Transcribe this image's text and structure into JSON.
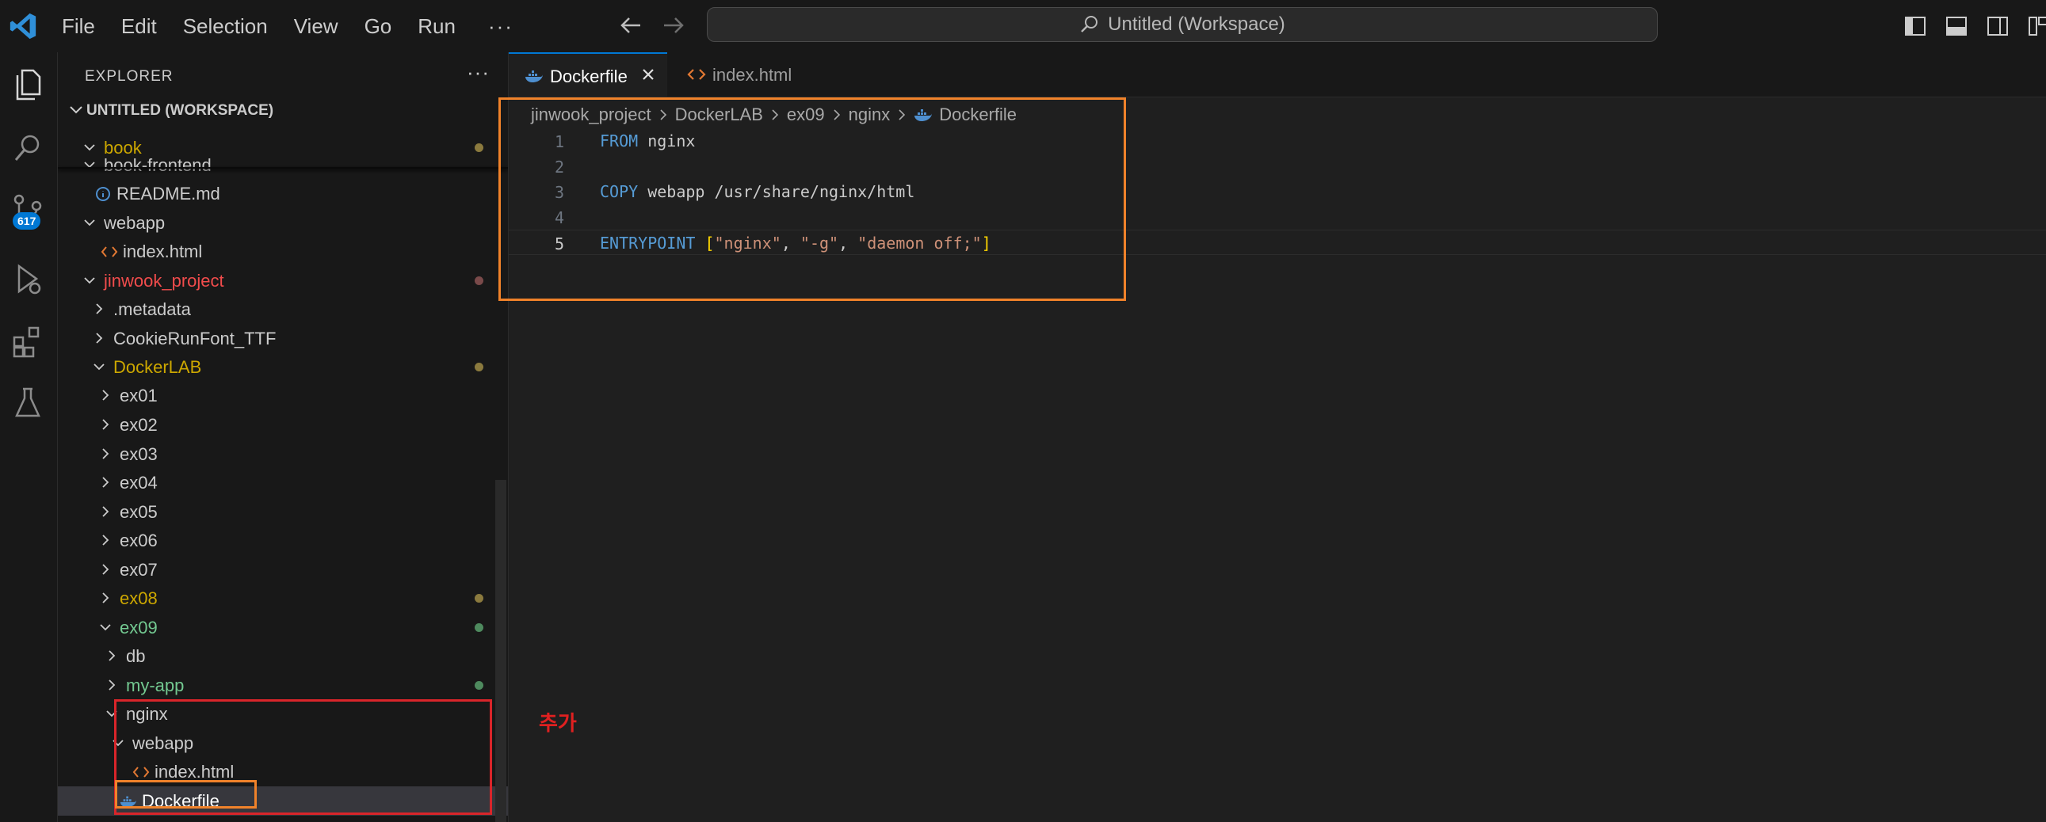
{
  "titlebar": {
    "menu": [
      "File",
      "Edit",
      "Selection",
      "View",
      "Go",
      "Run"
    ],
    "more": "···",
    "command_center": "Untitled (Workspace)"
  },
  "activity": {
    "scm_badge": "617"
  },
  "explorer": {
    "title": "EXPLORER",
    "more": "···",
    "workspace": "UNTITLED (WORKSPACE)",
    "rows": [
      {
        "label": "book",
        "kind": "folder-open",
        "color": "#cca700",
        "dot": "#8b7a3e"
      },
      {
        "label": "book-frontend",
        "kind": "folder-open",
        "color": "#cccccc"
      },
      {
        "label": "README.md",
        "kind": "info",
        "color": "#cccccc"
      },
      {
        "label": "webapp",
        "kind": "folder-open",
        "color": "#cccccc"
      },
      {
        "label": "index.html",
        "kind": "html",
        "color": "#cccccc"
      },
      {
        "label": "jinwook_project",
        "kind": "folder-open",
        "color": "#f14c4c",
        "dot": "#7a4a4a"
      },
      {
        "label": ".metadata",
        "kind": "folder",
        "color": "#cccccc"
      },
      {
        "label": "CookieRunFont_TTF",
        "kind": "folder",
        "color": "#cccccc"
      },
      {
        "label": "DockerLAB",
        "kind": "folder-open",
        "color": "#cca700",
        "dot": "#8b7a3e"
      },
      {
        "label": "ex01",
        "kind": "folder",
        "color": "#cccccc"
      },
      {
        "label": "ex02",
        "kind": "folder",
        "color": "#cccccc"
      },
      {
        "label": "ex03",
        "kind": "folder",
        "color": "#cccccc"
      },
      {
        "label": "ex04",
        "kind": "folder",
        "color": "#cccccc"
      },
      {
        "label": "ex05",
        "kind": "folder",
        "color": "#cccccc"
      },
      {
        "label": "ex06",
        "kind": "folder",
        "color": "#cccccc"
      },
      {
        "label": "ex07",
        "kind": "folder",
        "color": "#cccccc"
      },
      {
        "label": "ex08",
        "kind": "folder",
        "color": "#cca700",
        "dot": "#8b7a3e"
      },
      {
        "label": "ex09",
        "kind": "folder-open",
        "color": "#73c991",
        "dot": "#4e8a5e"
      },
      {
        "label": "db",
        "kind": "folder",
        "color": "#cccccc"
      },
      {
        "label": "my-app",
        "kind": "folder",
        "color": "#73c991",
        "dot": "#4e8a5e"
      },
      {
        "label": "nginx",
        "kind": "folder-open",
        "color": "#cccccc"
      },
      {
        "label": "webapp",
        "kind": "folder-open",
        "color": "#cccccc"
      },
      {
        "label": "index.html",
        "kind": "html",
        "color": "#cccccc"
      },
      {
        "label": "Dockerfile",
        "kind": "docker",
        "color": "#ffffff",
        "selected": true
      }
    ]
  },
  "editor": {
    "tabs": [
      {
        "label": "Dockerfile",
        "active": true
      },
      {
        "label": "index.html",
        "active": false
      }
    ],
    "breadcrumb": [
      "jinwook_project",
      "DockerLAB",
      "ex09",
      "nginx",
      "Dockerfile"
    ],
    "lines": [
      {
        "n": "1",
        "kw": "FROM",
        "rest": " nginx"
      },
      {
        "n": "2"
      },
      {
        "n": "3",
        "kw": "COPY",
        "rest": " webapp /usr/share/nginx/html"
      },
      {
        "n": "4"
      },
      {
        "n": "5",
        "kw": "ENTRYPOINT",
        "entry": [
          "\"nginx\"",
          "\"-g\"",
          "\"daemon off;\""
        ],
        "current": true
      }
    ]
  },
  "annotation": {
    "text": "추가",
    "color": "#e02020"
  },
  "colors": {
    "accent": "#0078d4",
    "highlight_orange": "#f0822a",
    "highlight_red": "#d9252a"
  }
}
